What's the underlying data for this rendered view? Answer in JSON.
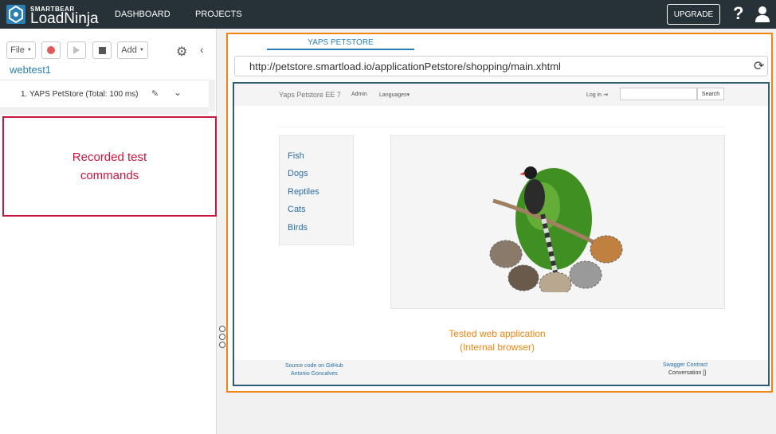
{
  "brand": {
    "company": "SMARTBEAR",
    "product": "LoadNinja"
  },
  "nav": {
    "dashboard": "DASHBOARD",
    "projects": "PROJECTS",
    "upgrade": "UPGRADE",
    "help": "?"
  },
  "toolbar": {
    "file_label": "File",
    "add_label": "Add"
  },
  "test": {
    "name": "webtest1",
    "item_label": "1. YAPS PetStore (Total: 100 ms)"
  },
  "annotations": {
    "commands_line1": "Recorded test",
    "commands_line2": "commands",
    "app_line1": "Tested web application",
    "app_line2": "(Internal browser)"
  },
  "browser": {
    "tab_label": "YAPS PETSTORE",
    "url": "http://petstore.smartload.io/applicationPetstore/shopping/main.xhtml"
  },
  "petstore": {
    "brand": "Yaps Petstore EE 7",
    "admin": "Admin",
    "languages": "Languages",
    "login": "Log in",
    "search_button": "Search",
    "categories": [
      {
        "label": "Fish"
      },
      {
        "label": "Dogs"
      },
      {
        "label": "Reptiles"
      },
      {
        "label": "Cats"
      },
      {
        "label": "Birds"
      }
    ],
    "footer": {
      "source": "Source code on GitHub",
      "author": "Antonio Goncalves",
      "swagger": "Swagger Contract",
      "conversation": "Conversation []"
    }
  },
  "colors": {
    "navbar": "#263238",
    "accent": "#2a7fb5",
    "annotation_red": "#c8163f",
    "annotation_orange": "#f0860f",
    "browser_border": "#2d5c78"
  },
  "icons": [
    "logo-icon",
    "help-icon",
    "user-icon",
    "record-icon",
    "play-icon",
    "stop-icon",
    "gear-icon",
    "collapse-icon",
    "pencil-icon",
    "chevron-down-icon",
    "refresh-icon",
    "login-icon"
  ]
}
